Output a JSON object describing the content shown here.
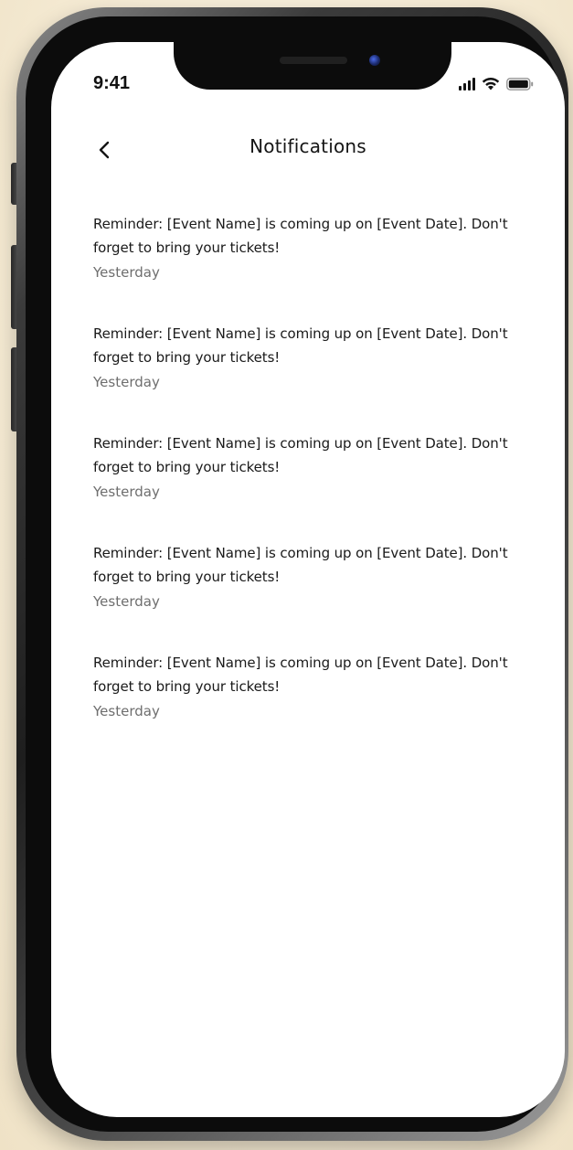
{
  "status_bar": {
    "time": "9:41",
    "signal_icon": "cellular-signal-icon",
    "wifi_icon": "wifi-icon",
    "battery_icon": "battery-icon"
  },
  "header": {
    "back_icon": "chevron-left-icon",
    "title": "Notifications"
  },
  "notifications": [
    {
      "message": "Reminder: [Event Name] is coming up on [Event Date]. Don't forget to bring your tickets!",
      "time": "Yesterday"
    },
    {
      "message": "Reminder: [Event Name] is coming up on [Event Date]. Don't forget to bring your tickets!",
      "time": "Yesterday"
    },
    {
      "message": "Reminder: [Event Name] is coming up on [Event Date]. Don't forget to bring your tickets!",
      "time": "Yesterday"
    },
    {
      "message": "Reminder: [Event Name] is coming up on [Event Date]. Don't forget to bring your tickets!",
      "time": "Yesterday"
    },
    {
      "message": "Reminder: [Event Name] is coming up on [Event Date]. Don't forget to bring your tickets!",
      "time": "Yesterday"
    }
  ],
  "colors": {
    "background": "#f7efdd",
    "screen": "#ffffff",
    "text_primary": "#1a1a1a",
    "text_secondary": "#6e6e6e"
  }
}
